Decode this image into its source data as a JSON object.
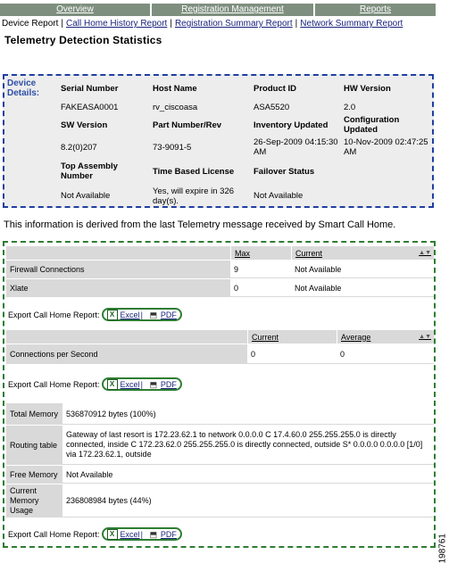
{
  "top_nav": [
    "Overview",
    "Registration Management",
    "Reports"
  ],
  "sub_nav": {
    "current": "Device Report",
    "links": [
      "Call Home History Report",
      "Registration Summary Report",
      "Network Summary Report"
    ]
  },
  "page_title": "Telemetry Detection Statistics",
  "device_details": {
    "label_line1": "Device",
    "label_line2": "Details:",
    "fields": [
      {
        "label": "Serial Number",
        "value": "FAKEASA0001"
      },
      {
        "label": "Host Name",
        "value": "rv_ciscoasa"
      },
      {
        "label": "Product ID",
        "value": "ASA5520"
      },
      {
        "label": "HW Version",
        "value": "2.0"
      },
      {
        "label": "SW Version",
        "value": "8.2(0)207"
      },
      {
        "label": "Part Number/Rev",
        "value": "73-9091-5"
      },
      {
        "label": "Inventory Updated",
        "value": "26-Sep-2009 04:15:30 AM"
      },
      {
        "label": "Configuration Updated",
        "value": "10-Nov-2009 02:47:25 AM"
      },
      {
        "label": "Top Assembly Number",
        "value": "Not Available"
      },
      {
        "label": "Time Based License",
        "value": "Yes, will expire in 326 day(s)."
      },
      {
        "label": "Failover Status",
        "value": "Not Available"
      }
    ]
  },
  "info_text": "This information is derived from the last Telemetry message received by Smart Call Home.",
  "table1": {
    "headers": [
      "Max",
      "Current"
    ],
    "rows": [
      {
        "label": "Firewall Connections",
        "max": "9",
        "current": "Not Available"
      },
      {
        "label": "Xlate",
        "max": "0",
        "current": "Not Available"
      }
    ]
  },
  "table2": {
    "headers": [
      "Current",
      "Average"
    ],
    "rows": [
      {
        "label": "Connections per Second",
        "current": "0",
        "average": "0"
      }
    ]
  },
  "table3": {
    "rows": [
      {
        "label": "Total Memory",
        "value": "536870912 bytes (100%)"
      },
      {
        "label": "Routing table",
        "value": "Gateway of last resort is 172.23.62.1 to network 0.0.0.0 C 17.4.60.0 255.255.255.0 is directly connected, inside C 172.23.62.0 255.255.255.0 is directly connected, outside S* 0.0.0.0 0.0.0.0 [1/0] via 172.23.62.1, outside"
      },
      {
        "label": "Free Memory",
        "value": "Not Available"
      },
      {
        "label": "Current Memory Usage",
        "value": "236808984 bytes (44%)"
      }
    ]
  },
  "export": {
    "label": "Export Call Home Report:",
    "excel": "Excel",
    "pdf": "PDF",
    "separator": "|"
  },
  "figure_id": "198761"
}
